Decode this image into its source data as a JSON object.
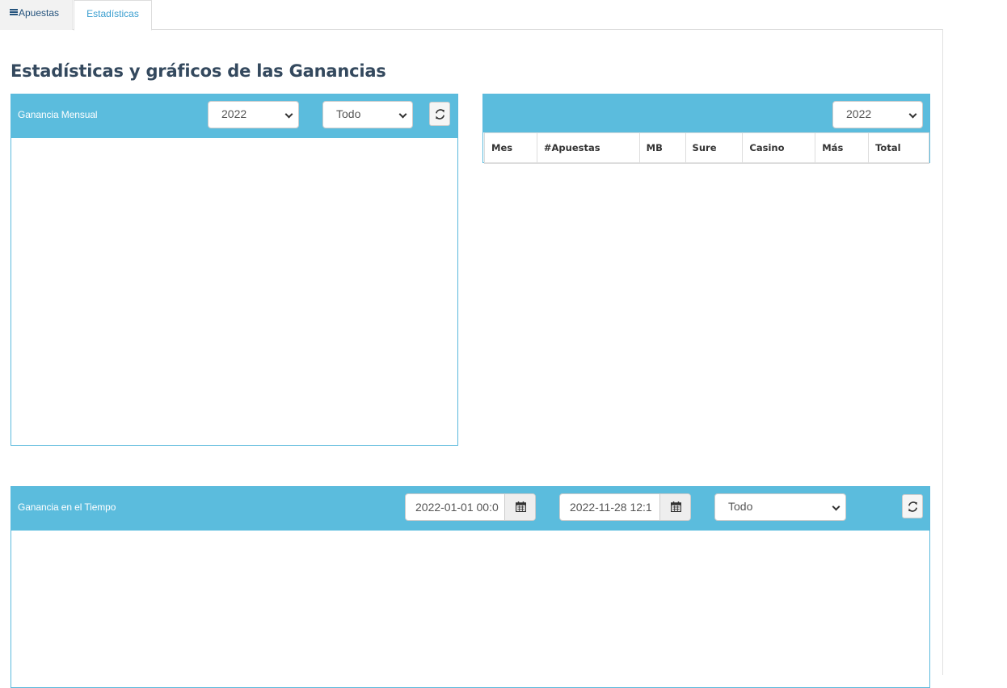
{
  "tabs": [
    {
      "label": "Apuestas",
      "icon": "hamburger-icon"
    },
    {
      "label": "Estadísticas",
      "active": true
    }
  ],
  "page_title": "Estadísticas y gráficos de las Ganancias",
  "monthly_panel": {
    "title": "Ganancia Mensual",
    "year_select": "2022",
    "type_select": "Todo",
    "refresh_icon": "refresh-icon"
  },
  "table_panel": {
    "year_select": "2022",
    "columns": [
      "Mes",
      "#Apuestas",
      "MB",
      "Sure",
      "Casino",
      "Más",
      "Total"
    ]
  },
  "time_panel": {
    "title": "Ganancia en el Tiempo",
    "date_from": "2022-01-01 00:0",
    "date_to": "2022-11-28 12:1",
    "type_select": "Todo",
    "calendar_icon": "calendar-icon",
    "refresh_icon": "refresh-icon"
  },
  "colors": {
    "panel_header": "#5bbcdd",
    "title": "#34495e",
    "active_tab": "#3c9fd0"
  }
}
